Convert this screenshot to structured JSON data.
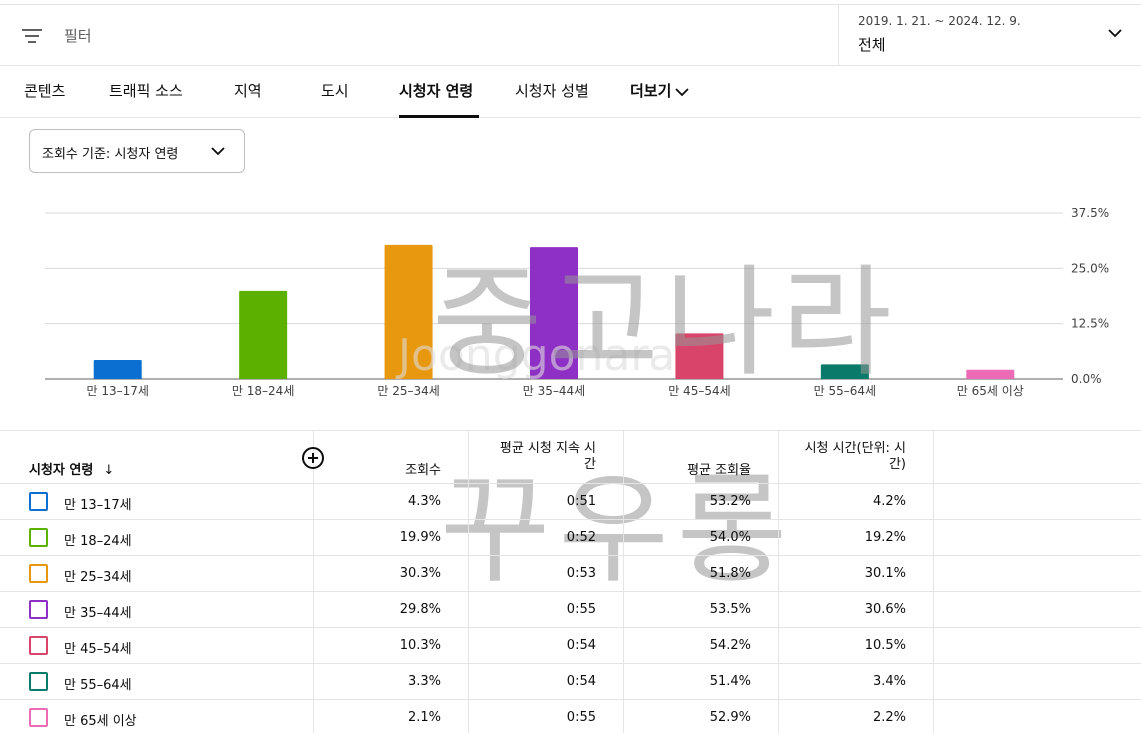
{
  "filter_bar": {
    "filter_label": "필터",
    "date_range": "2019. 1. 21. ~ 2024. 12. 9.",
    "period_label": "전체"
  },
  "tabs": [
    {
      "label": "콘텐츠"
    },
    {
      "label": "트래픽 소스"
    },
    {
      "label": "지역"
    },
    {
      "label": "도시"
    },
    {
      "label": "시청자 연령",
      "active": true
    },
    {
      "label": "시청자 성별"
    },
    {
      "label": "더보기"
    }
  ],
  "metric_select": {
    "value": "조회수 기준: 시청자 연령"
  },
  "chart_data": {
    "type": "bar",
    "categories": [
      "만 13–17세",
      "만 18–24세",
      "만 25–34세",
      "만 35–44세",
      "만 45–54세",
      "만 55–64세",
      "만 65세 이상"
    ],
    "values": [
      4.3,
      19.9,
      30.3,
      29.8,
      10.3,
      3.3,
      2.1
    ],
    "colors": [
      "#0b6ed1",
      "#5bb000",
      "#e8980e",
      "#8e2fc5",
      "#d9456a",
      "#0a7a6a",
      "#ec6bb5"
    ],
    "yticks": [
      "37.5%",
      "25.0%",
      "12.5%",
      "0.0%"
    ],
    "ytick_values": [
      37.5,
      25.0,
      12.5,
      0.0
    ],
    "ylim": [
      0,
      37.5
    ],
    "grid": true
  },
  "watermark": {
    "main": "중고나라",
    "sub": "꾸우롱",
    "url": "Joonggonara"
  },
  "table": {
    "headers": {
      "age": "시청자 연령",
      "sort_arrow": "↓",
      "views": "조회수",
      "avg_duration": "평균 시청 지속 시간",
      "avg_percent": "평균 조회율",
      "watch_time": "시청 시간(단위: 시간)"
    },
    "rows": [
      {
        "label": "만 13–17세",
        "color": "#0b6ed1",
        "views": "4.3%",
        "duration": "0:51",
        "percent": "53.2%",
        "watch": "4.2%"
      },
      {
        "label": "만 18–24세",
        "color": "#5bb000",
        "views": "19.9%",
        "duration": "0:52",
        "percent": "54.0%",
        "watch": "19.2%"
      },
      {
        "label": "만 25–34세",
        "color": "#e8980e",
        "views": "30.3%",
        "duration": "0:53",
        "percent": "51.8%",
        "watch": "30.1%"
      },
      {
        "label": "만 35–44세",
        "color": "#8e2fc5",
        "views": "29.8%",
        "duration": "0:55",
        "percent": "53.5%",
        "watch": "30.6%"
      },
      {
        "label": "만 45–54세",
        "color": "#d9456a",
        "views": "10.3%",
        "duration": "0:54",
        "percent": "54.2%",
        "watch": "10.5%"
      },
      {
        "label": "만 55–64세",
        "color": "#0a7a6a",
        "views": "3.3%",
        "duration": "0:54",
        "percent": "51.4%",
        "watch": "3.4%"
      },
      {
        "label": "만 65세 이상",
        "color": "#ec6bb5",
        "views": "2.1%",
        "duration": "0:55",
        "percent": "52.9%",
        "watch": "2.2%"
      }
    ]
  }
}
